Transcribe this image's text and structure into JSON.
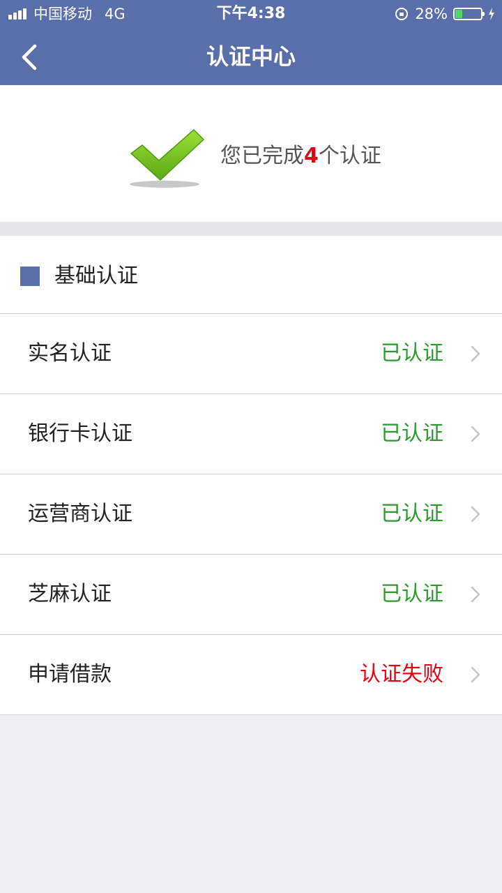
{
  "status_bar": {
    "carrier": "中国移动",
    "network": "4G",
    "time": "下午4:38",
    "battery": "28%",
    "battery_level": 0.28
  },
  "navbar": {
    "title": "认证中心",
    "back_icon": "chevron-left-icon"
  },
  "summary": {
    "prefix": "您已完成",
    "count": "4",
    "suffix": "个认证",
    "icon": "checkmark-icon"
  },
  "section": {
    "title": "基础认证"
  },
  "items": [
    {
      "label": "实名认证",
      "status": "已认证",
      "state": "ok"
    },
    {
      "label": "银行卡认证",
      "status": "已认证",
      "state": "ok"
    },
    {
      "label": "运营商认证",
      "status": "已认证",
      "state": "ok"
    },
    {
      "label": "芝麻认证",
      "status": "已认证",
      "state": "ok"
    },
    {
      "label": "申请借款",
      "status": "认证失败",
      "state": "fail"
    }
  ],
  "colors": {
    "brand": "#5a6fa9",
    "verified": "#2c9a2c",
    "failed": "#e60012",
    "background": "#efeff4"
  }
}
